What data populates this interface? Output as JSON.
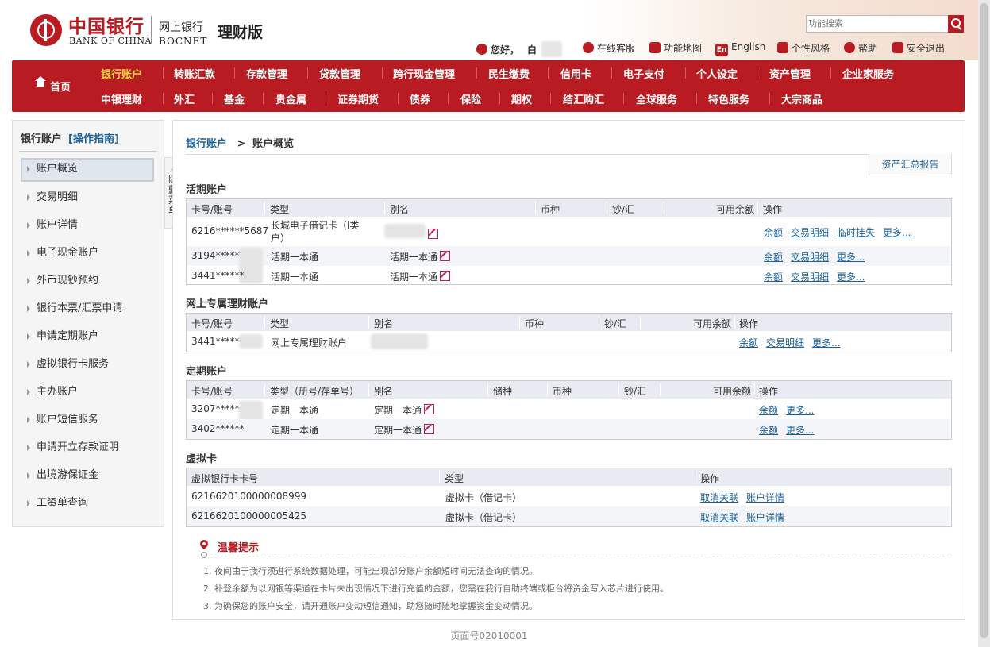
{
  "header": {
    "logo_cn": "中国银行",
    "logo_en": "BANK OF CHINA",
    "net_cn": "网上银行",
    "net_en": "BOCNET",
    "edition": "理财版",
    "search_placeholder": "功能搜索",
    "greeting": "您好，",
    "greeting_name": "白",
    "links": [
      "在线客服",
      "功能地图",
      "English",
      "个性风格",
      "帮助",
      "安全退出"
    ],
    "english_badge": "En"
  },
  "nav": {
    "home": "首页",
    "row1": [
      "银行账户",
      "转账汇款",
      "存款管理",
      "贷款管理",
      "跨行现金管理",
      "民生缴费",
      "信用卡",
      "电子支付",
      "个人设定",
      "资产管理",
      "企业家服务"
    ],
    "row2": [
      "中银理财",
      "外汇",
      "基金",
      "贵金属",
      "证券期货",
      "债券",
      "保险",
      "期权",
      "结汇购汇",
      "全球服务",
      "特色服务",
      "大宗商品"
    ],
    "active": "银行账户"
  },
  "sidebar": {
    "title": "银行账户",
    "guide": "[操作指南]",
    "items": [
      "账户概览",
      "交易明细",
      "账户详情",
      "电子现金账户",
      "外币现钞预约",
      "银行本票/汇票申请",
      "申请定期账户",
      "虚拟银行卡服务",
      "主办账户",
      "账户短信服务",
      "申请开立存款证明",
      "出境游保证金",
      "工资单查询"
    ],
    "collapse_label": "隐藏菜单"
  },
  "breadcrumb": {
    "parent": "银行账户",
    "sep": ">",
    "current": "账户概览"
  },
  "report_button": "资产汇总报告",
  "current_accounts": {
    "title": "活期账户",
    "headers": [
      "卡号/账号",
      "类型",
      "别名",
      "币种",
      "钞/汇",
      "可用余额",
      "操作"
    ],
    "rows": [
      {
        "no": "6216******5687",
        "type": "长城电子借记卡（Ⅰ类户）",
        "alias": "",
        "ops": [
          "余额",
          "交易明细",
          "临时挂失",
          "更多..."
        ]
      },
      {
        "no": "3194******",
        "type": "活期一本通",
        "alias": "活期一本通",
        "ops": [
          "余额",
          "交易明细",
          "更多..."
        ]
      },
      {
        "no": "3441******",
        "type": "活期一本通",
        "alias": "活期一本通",
        "ops": [
          "余额",
          "交易明细",
          "更多..."
        ]
      }
    ]
  },
  "wealth_accounts": {
    "title": "网上专属理财账户",
    "headers": [
      "卡号/账号",
      "类型",
      "别名",
      "币种",
      "钞/汇",
      "可用余额",
      "操作"
    ],
    "rows": [
      {
        "no": "3441******",
        "type": "网上专属理财账户",
        "alias": "",
        "ops": [
          "余额",
          "交易明细",
          "更多..."
        ]
      }
    ]
  },
  "fixed_accounts": {
    "title": "定期账户",
    "headers": [
      "卡号/账号",
      "类型（册号/存单号）",
      "别名",
      "储种",
      "币种",
      "钞/汇",
      "可用余额",
      "操作"
    ],
    "rows": [
      {
        "no": "3207******",
        "type": "定期一本通",
        "alias": "定期一本通",
        "ops": [
          "余额",
          "更多..."
        ]
      },
      {
        "no": "3402******",
        "type": "定期一本通",
        "alias": "定期一本通",
        "ops": [
          "余额",
          "更多..."
        ]
      }
    ]
  },
  "virtual_cards": {
    "title": "虚拟卡",
    "headers": [
      "虚拟银行卡卡号",
      "类型",
      "操作"
    ],
    "rows": [
      {
        "no": "6216620100000008999",
        "type": "虚拟卡（借记卡）",
        "ops": [
          "取消关联",
          "账户详情"
        ]
      },
      {
        "no": "6216620100000005425",
        "type": "虚拟卡（借记卡）",
        "ops": [
          "取消关联",
          "账户详情"
        ]
      }
    ]
  },
  "tips": {
    "title": "温馨提示",
    "lines": [
      "1. 夜间由于我行须进行系统数据处理，可能出现部分账户余额短时间无法查询的情况。",
      "2. 补登余额为以网银等渠道在卡片未出现情况下进行充值的金额，您需在我行自助终端或柜台将资金写入芯片进行使用。",
      "3. 为确保您的账户安全，请开通账户变动短信通知，助您随时随地掌握资金变动情况。"
    ]
  },
  "footer": "页面号02010001",
  "colors": {
    "brand_red": "#b81c22",
    "link_blue": "#1c5f94",
    "nav_active": "#f9d24d"
  }
}
